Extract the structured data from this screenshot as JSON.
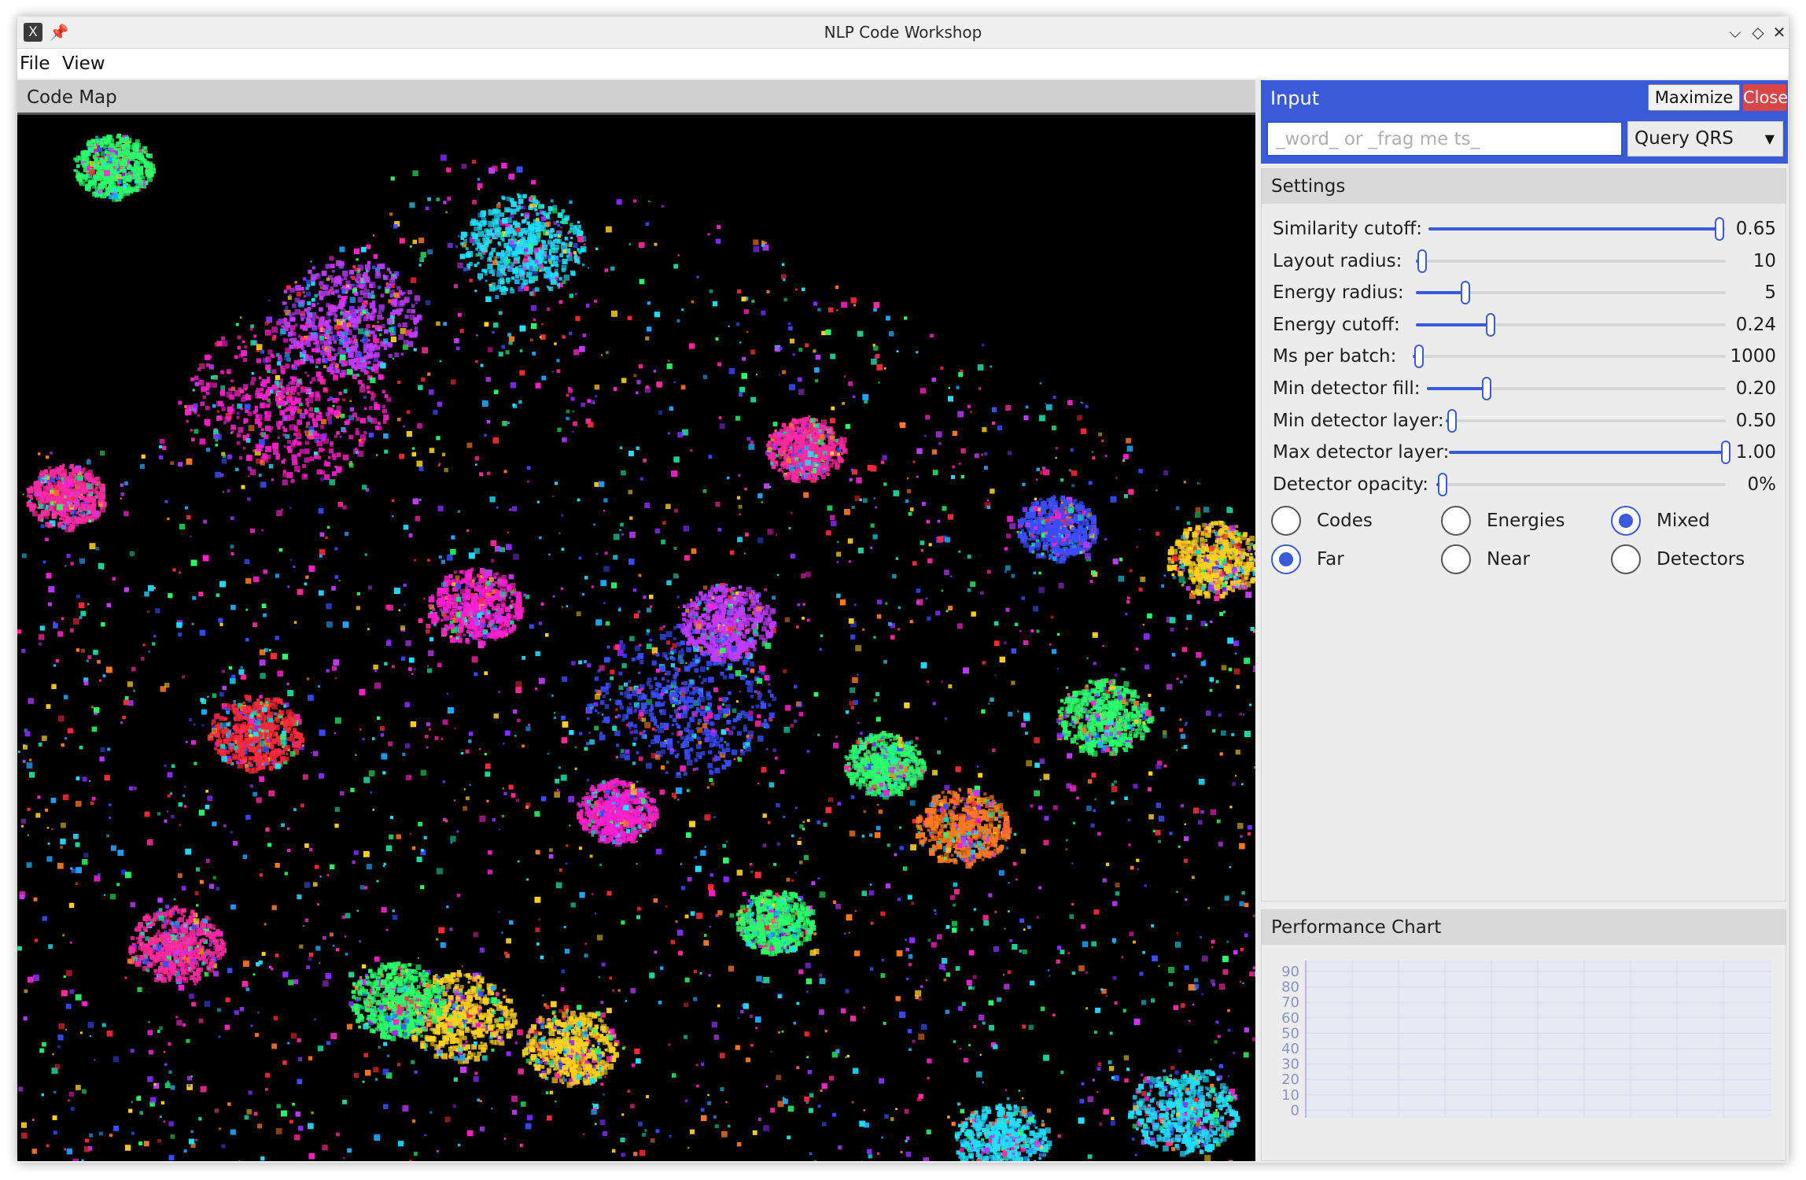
{
  "window": {
    "title": "NLP Code Workshop",
    "app_icon": "X",
    "pin_icon": "📌",
    "controls": {
      "minimize": "⌵",
      "maximize": "◇",
      "close": "✕"
    }
  },
  "menubar": {
    "items": [
      "File",
      "View"
    ]
  },
  "code_map": {
    "title": "Code Map"
  },
  "input_panel": {
    "title": "Input",
    "maximize_label": "Maximize",
    "close_label": "Close",
    "search_placeholder": "_word_ or _frag me ts_",
    "query_select_value": "Query QRS",
    "accent_color": "#3a5bd9",
    "close_color": "#d9464a"
  },
  "settings": {
    "title": "Settings",
    "sliders": [
      {
        "label": "Similarity cutoff:",
        "value": "0.65",
        "fraction": 0.98
      },
      {
        "label": "Layout radius:",
        "value": "10",
        "fraction": 0.0
      },
      {
        "label": "Energy radius:",
        "value": "5",
        "fraction": 0.16
      },
      {
        "label": "Energy cutoff:",
        "value": "0.24",
        "fraction": 0.24
      },
      {
        "label": "Ms per batch:",
        "value": "1000",
        "fraction": 0.0
      },
      {
        "label": "Min detector fill:",
        "value": "0.20",
        "fraction": 0.2
      },
      {
        "label": "Min detector layer:",
        "value": "0.50",
        "fraction": 0.0
      },
      {
        "label": "Max detector layer:",
        "value": "1.00",
        "fraction": 1.0
      },
      {
        "label": "Detector opacity:",
        "value": "0%",
        "fraction": 0.0
      }
    ],
    "radio_groups": [
      [
        {
          "label": "Codes",
          "selected": false
        },
        {
          "label": "Energies",
          "selected": false
        },
        {
          "label": "Mixed",
          "selected": true
        }
      ],
      [
        {
          "label": "Far",
          "selected": true
        },
        {
          "label": "Near",
          "selected": false
        },
        {
          "label": "Detectors",
          "selected": false
        }
      ]
    ]
  },
  "performance": {
    "title": "Performance Chart",
    "y_ticks": [
      "90",
      "80",
      "70",
      "60",
      "50",
      "40",
      "30",
      "20",
      "10",
      "0"
    ],
    "tick_color": "#8a93c8"
  }
}
